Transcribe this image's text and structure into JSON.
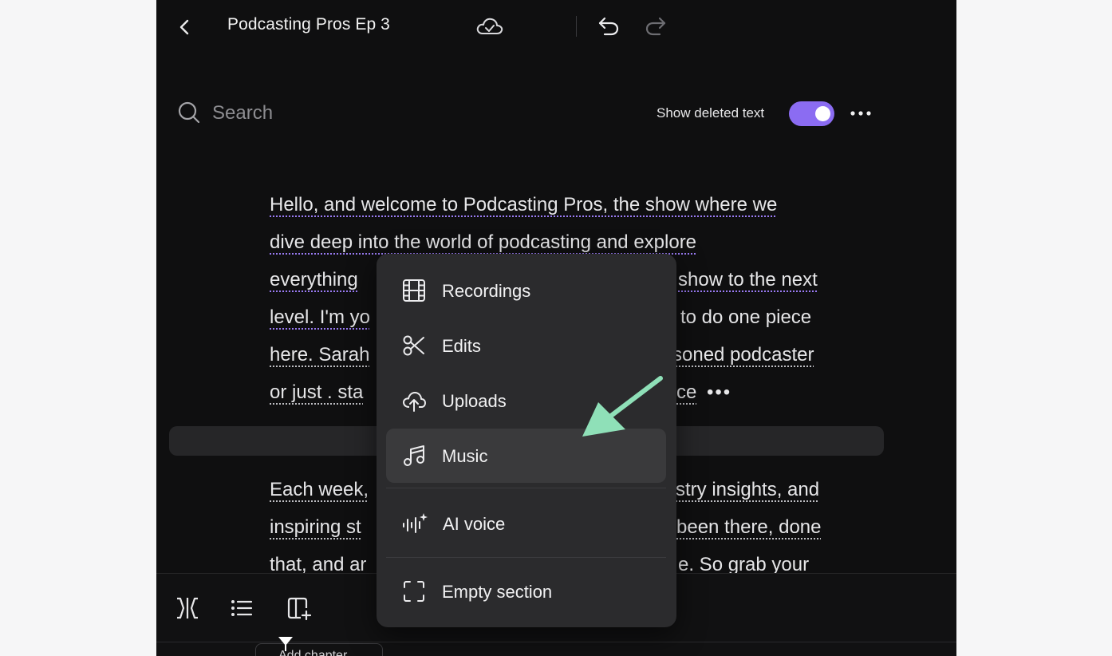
{
  "header": {
    "title": "Podcasting Pros Ep 3",
    "icons": [
      "back-chevron-icon",
      "cloud-check-icon",
      "undo-icon",
      "redo-icon"
    ]
  },
  "search": {
    "placeholder": "Search",
    "value": ""
  },
  "show_deleted": {
    "label": "Show deleted text",
    "enabled": true
  },
  "colors": {
    "accent": "#8b6cf2",
    "app_background": "#0f0f10",
    "menu_background": "#2b2b2d",
    "annotation_arrow": "#8fe0b8"
  },
  "transcript": {
    "para1_lines": [
      "Hello, and welcome to Podcasting Pros, the show where we",
      "dive deep into the world of podcasting and explore",
      "everything",
      "show to the next",
      "level. I'm yo",
      "w to do one piece",
      "here. Sarah",
      "soned podcaster",
      "or just . sta",
      "ce",
      "•••"
    ],
    "para2_lines": [
      "Each week,",
      "stry insights, and",
      "inspiring st",
      "been there, done",
      "that, and ar",
      "e. So grab your"
    ]
  },
  "menu": {
    "items": [
      {
        "label": "Recordings",
        "icon": "film-icon"
      },
      {
        "label": "Edits",
        "icon": "scissors-icon"
      },
      {
        "label": "Uploads",
        "icon": "cloud-upload-icon"
      },
      {
        "label": "Music",
        "icon": "music-note-icon",
        "highlighted": true
      },
      {
        "label": "AI voice",
        "icon": "ai-voice-icon"
      },
      {
        "label": "Empty section",
        "icon": "empty-section-icon"
      }
    ]
  },
  "bottom_toolbar": {
    "icons": [
      "split-icon",
      "list-icon",
      "add-panel-icon"
    ],
    "add_chapter_label": "Add chapter"
  }
}
